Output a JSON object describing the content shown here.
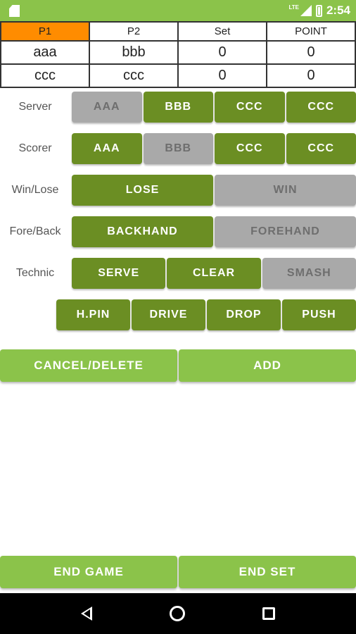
{
  "status": {
    "time": "2:54",
    "network": "LTE"
  },
  "score_table": {
    "headers": [
      "P1",
      "P2",
      "Set",
      "POINT"
    ],
    "rows": [
      [
        "aaa",
        "bbb",
        "0",
        "0"
      ],
      [
        "ccc",
        "ccc",
        "0",
        "0"
      ]
    ]
  },
  "labels": {
    "server": "Server",
    "scorer": "Scorer",
    "win_lose": "Win/Lose",
    "fore_back": "Fore/Back",
    "technic": "Technic"
  },
  "server": [
    "AAA",
    "BBB",
    "CCC",
    "CCC"
  ],
  "scorer": [
    "AAA",
    "BBB",
    "CCC",
    "CCC"
  ],
  "win_lose": [
    "LOSE",
    "WIN"
  ],
  "fore_back": [
    "BACKHAND",
    "FOREHAND"
  ],
  "technic_row1": [
    "SERVE",
    "CLEAR",
    "SMASH"
  ],
  "technic_row2": [
    "H.PIN",
    "DRIVE",
    "DROP",
    "PUSH"
  ],
  "actions": {
    "cancel": "CANCEL/DELETE",
    "add": "ADD",
    "end_game": "END GAME",
    "end_set": "END SET"
  },
  "colors": {
    "selected": "#6b8e23",
    "unselected": "#a9a9a9",
    "accent": "#8bc34a",
    "active_header": "#ff8c00"
  }
}
